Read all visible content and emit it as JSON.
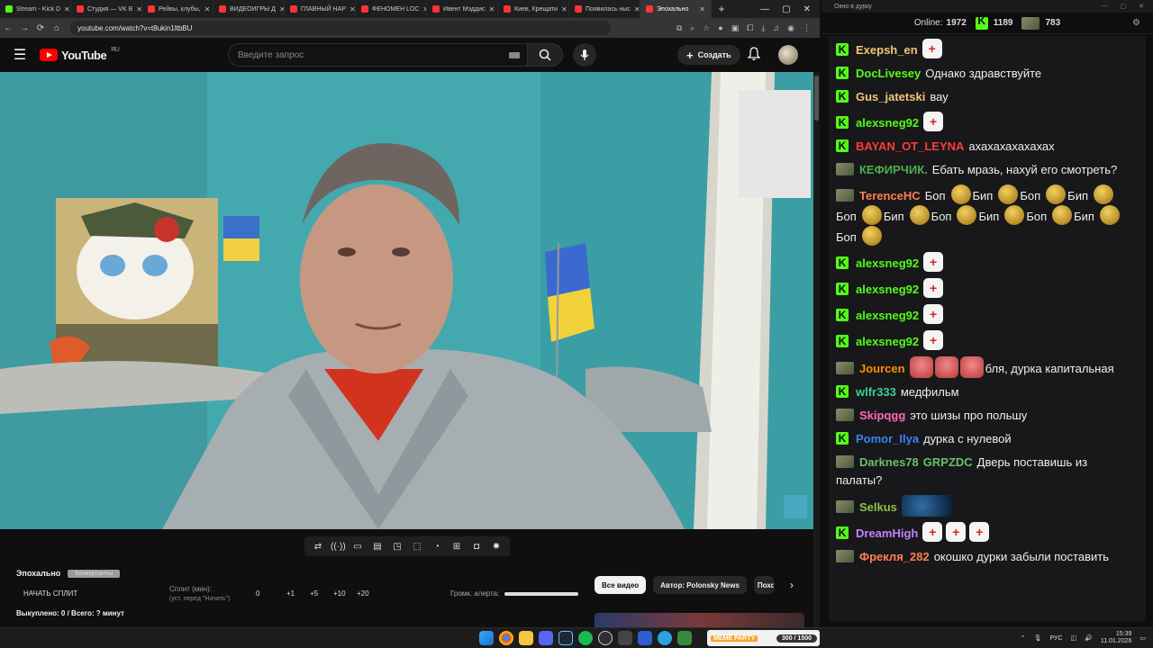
{
  "browser": {
    "tabs": [
      {
        "title": "Stream - Kick D",
        "color": "#53fc18"
      },
      {
        "title": "Студия — VK В",
        "color": "#ff3333"
      },
      {
        "title": "Рейвы, клубы,",
        "color": "#ff3333"
      },
      {
        "title": "ВИДЕОИГРЫ Д",
        "color": "#ff3333"
      },
      {
        "title": "ГЛАВНЫЙ НАР",
        "color": "#ff3333"
      },
      {
        "title": "ФЕНОМЕН LOC",
        "color": "#ff3333"
      },
      {
        "title": "Ивент Мэддис",
        "color": "#ff3333"
      },
      {
        "title": "Киев, Крещати",
        "color": "#ff3333"
      },
      {
        "title": "Появилась ныс",
        "color": "#ff3333"
      },
      {
        "title": "Эпохально",
        "color": "#ff3333",
        "active": true
      }
    ],
    "url": "youtube.com/watch?v=t8ukin1ltbBU"
  },
  "youtube": {
    "logo_text": "YouTube",
    "logo_region": "RU",
    "search_placeholder": "Введите запрос",
    "create_label": "Создать"
  },
  "player_tools": {
    "icons": [
      "repeat-icon",
      "broadcast-icon",
      "cast-icon",
      "film-icon",
      "pip-icon",
      "frame-icon",
      "speed-icon",
      "add-icon",
      "camera-icon",
      "settings-icon"
    ]
  },
  "split": {
    "title": "Эпохально",
    "badge": "Конкурсанты",
    "start_label": "НАЧАТЬ СПЛИТ",
    "label": "Сплит (мин):",
    "sublabel": "(уст. перед \"Начать\")",
    "values": [
      "0",
      "+1",
      "+5",
      "+10",
      "+20"
    ],
    "bought": "Выкуплено: 0 / Всего: ? минут",
    "alert_volume_label": "Громк. алерта:"
  },
  "chips": [
    {
      "label": "Все видео",
      "active": true
    },
    {
      "label": "Автор: Polonsky News",
      "active": false
    },
    {
      "label": "Похо",
      "active": false
    }
  ],
  "chat_window": {
    "title": "Окно в дурку",
    "online_label": "Online:",
    "online_count": "1972",
    "kick_count": "1189",
    "other_count": "783"
  },
  "chat": [
    {
      "platform": "kick",
      "user": "Exepsh_en",
      "color": "#f0c674",
      "parts": [
        {
          "emote": "doc"
        }
      ]
    },
    {
      "platform": "kick",
      "user": "DocLivesey",
      "color": "#53fc18",
      "parts": [
        {
          "text": "Однако здравствуйте"
        }
      ]
    },
    {
      "platform": "kick",
      "user": "Gus_jatetski",
      "color": "#f0c674",
      "parts": [
        {
          "text": "вау"
        }
      ]
    },
    {
      "platform": "kick",
      "user": "alexsneg92",
      "color": "#53fc18",
      "parts": [
        {
          "emote": "doc"
        }
      ]
    },
    {
      "platform": "kick",
      "user": "BAYAN_OT_LEYNA",
      "color": "#ff3b3b",
      "parts": [
        {
          "text": "ахахахахахахах"
        }
      ]
    },
    {
      "platform": "vk",
      "user": "КЕФИРЧИК.",
      "color": "#4caf50",
      "parts": [
        {
          "text": "Ебать мразь, нахуй его смотреть?"
        }
      ]
    },
    {
      "platform": "vk",
      "user": "TerenceHC",
      "color": "#ff7f50",
      "parts": [
        {
          "text": "Боп"
        },
        {
          "emote": "gold"
        },
        {
          "text": "Бип"
        },
        {
          "emote": "gold"
        },
        {
          "text": "Боп"
        },
        {
          "emote": "gold"
        },
        {
          "text": "Бип"
        },
        {
          "emote": "gold"
        },
        {
          "text": "Боп"
        },
        {
          "emote": "gold"
        },
        {
          "text": "Бип"
        },
        {
          "emote": "gold"
        },
        {
          "text": "Боп"
        },
        {
          "emote": "gold"
        },
        {
          "text": "Бип"
        },
        {
          "emote": "gold"
        },
        {
          "text": "Боп"
        },
        {
          "emote": "gold"
        },
        {
          "text": "Бип"
        },
        {
          "emote": "gold"
        },
        {
          "text": "Боп"
        },
        {
          "emote": "gold"
        }
      ]
    },
    {
      "platform": "kick",
      "user": "alexsneg92",
      "color": "#53fc18",
      "parts": [
        {
          "emote": "doc"
        }
      ]
    },
    {
      "platform": "kick",
      "user": "alexsneg92",
      "color": "#53fc18",
      "parts": [
        {
          "emote": "doc"
        }
      ]
    },
    {
      "platform": "kick",
      "user": "alexsneg92",
      "color": "#53fc18",
      "parts": [
        {
          "emote": "doc"
        }
      ]
    },
    {
      "platform": "kick",
      "user": "alexsneg92",
      "color": "#53fc18",
      "parts": [
        {
          "emote": "doc"
        }
      ]
    },
    {
      "platform": "vk",
      "user": "Jourcen",
      "color": "#ff8c00",
      "parts": [
        {
          "emote": "red"
        },
        {
          "emote": "red"
        },
        {
          "emote": "red"
        },
        {
          "text": "бля, дурка капитальная"
        }
      ]
    },
    {
      "platform": "kick",
      "user": "wlfr333",
      "color": "#3ecf8e",
      "parts": [
        {
          "text": "медфильм"
        }
      ]
    },
    {
      "platform": "vk",
      "user": "Skipqgg",
      "color": "#ff69b4",
      "parts": [
        {
          "text": "это шизы про польшу"
        }
      ]
    },
    {
      "platform": "kick",
      "user": "Pomor_Ilya",
      "color": "#3b82f6",
      "parts": [
        {
          "text": "дурка с нулевой"
        }
      ]
    },
    {
      "platform": "vk",
      "user": "Darknes78",
      "color": "#6abf69",
      "parts": [
        {
          "user2": "GRPZDC",
          "color2": "#6abf69"
        },
        {
          "text": "Дверь поставишь из палаты?"
        }
      ]
    },
    {
      "platform": "vk",
      "user": "Selkus",
      "color": "#8bc34a",
      "parts": [
        {
          "emote": "blue"
        }
      ]
    },
    {
      "platform": "kick",
      "user": "DreamHigh",
      "color": "#c084fc",
      "parts": [
        {
          "emote": "doc"
        },
        {
          "emote": "doc"
        },
        {
          "emote": "doc"
        }
      ]
    },
    {
      "platform": "vk",
      "user": "Фрекля_282",
      "color": "#ff7f50",
      "parts": [
        {
          "text": "окошко дурки забыли поставить"
        }
      ]
    }
  ],
  "taskbar": {
    "meme_label": "MEME PARTY",
    "meme_count": "300 / 1500",
    "lang": "РУС",
    "time": "15:39",
    "date": "11.01.2026"
  }
}
